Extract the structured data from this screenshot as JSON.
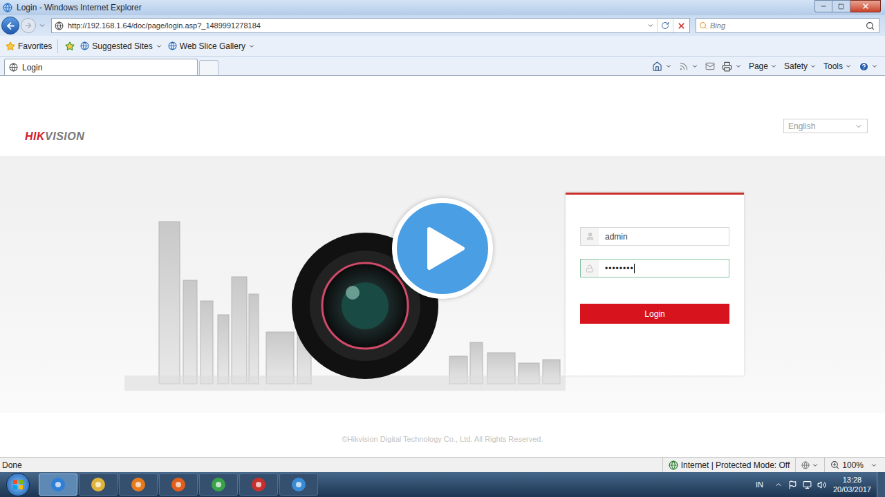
{
  "window": {
    "title": "Login - Windows Internet Explorer"
  },
  "address_bar": {
    "url": "http://192.168.1.64/doc/page/login.asp?_1489991278184"
  },
  "search": {
    "placeholder": "Bing"
  },
  "favorites_bar": {
    "label": "Favorites",
    "items": [
      "Suggested Sites",
      "Web Slice Gallery"
    ]
  },
  "tabs": [
    {
      "label": "Login",
      "selected": true
    }
  ],
  "command_bar": [
    "Page",
    "Safety",
    "Tools"
  ],
  "page": {
    "logo": {
      "part1": "HIK",
      "part2": "VISION"
    },
    "language": "English",
    "login": {
      "username": "admin",
      "password": "••••••••",
      "password_focused": true,
      "button": "Login"
    },
    "footer": "©Hikvision Digital Technology Co., Ltd. All Rights Reserved."
  },
  "status_bar": {
    "text": "Done",
    "zone": "Internet | Protected Mode: Off",
    "zoom": "100%"
  },
  "taskbar": {
    "language": "IN",
    "time": "13:28",
    "date": "20/03/2017"
  },
  "video_overlay": {
    "play_button": true
  }
}
